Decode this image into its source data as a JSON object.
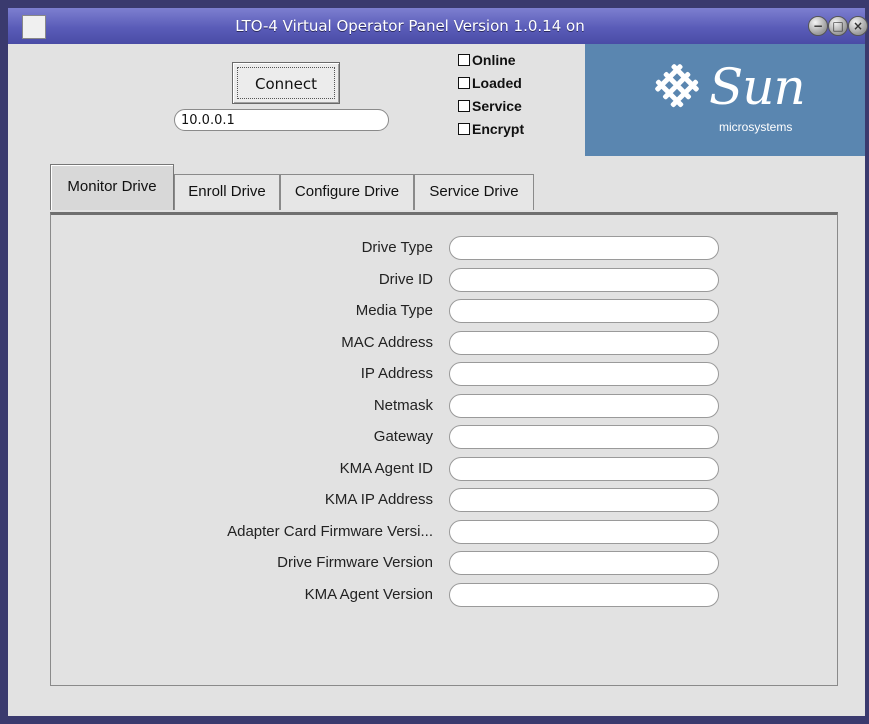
{
  "window": {
    "title": "LTO-4 Virtual Operator Panel Version 1.0.14 on",
    "buttons": {
      "minimize": "−",
      "maximize": "□",
      "close": "×"
    }
  },
  "connection": {
    "connect_label": "Connect",
    "ip_value": "10.0.0.1"
  },
  "status": [
    {
      "label": "Online",
      "checked": false
    },
    {
      "label": "Loaded",
      "checked": false
    },
    {
      "label": "Service",
      "checked": false
    },
    {
      "label": "Encrypt",
      "checked": false
    }
  ],
  "logo": {
    "brand": "Sun",
    "sub": "microsystems"
  },
  "tabs": [
    {
      "label": "Monitor Drive",
      "active": true
    },
    {
      "label": "Enroll Drive",
      "active": false
    },
    {
      "label": "Configure Drive",
      "active": false
    },
    {
      "label": "Service Drive",
      "active": false
    }
  ],
  "fields": [
    {
      "label": "Drive Type",
      "value": ""
    },
    {
      "label": "Drive ID",
      "value": ""
    },
    {
      "label": "Media Type",
      "value": ""
    },
    {
      "label": "MAC Address",
      "value": ""
    },
    {
      "label": "IP Address",
      "value": ""
    },
    {
      "label": "Netmask",
      "value": ""
    },
    {
      "label": "Gateway",
      "value": ""
    },
    {
      "label": "KMA Agent ID",
      "value": ""
    },
    {
      "label": "KMA IP Address",
      "value": ""
    },
    {
      "label": "Adapter Card Firmware Versi...",
      "value": ""
    },
    {
      "label": "Drive Firmware Version",
      "value": ""
    },
    {
      "label": "KMA Agent Version",
      "value": ""
    }
  ],
  "colors": {
    "logo_bg": "#5a86b0",
    "title_bar": "#5a5cb8"
  }
}
